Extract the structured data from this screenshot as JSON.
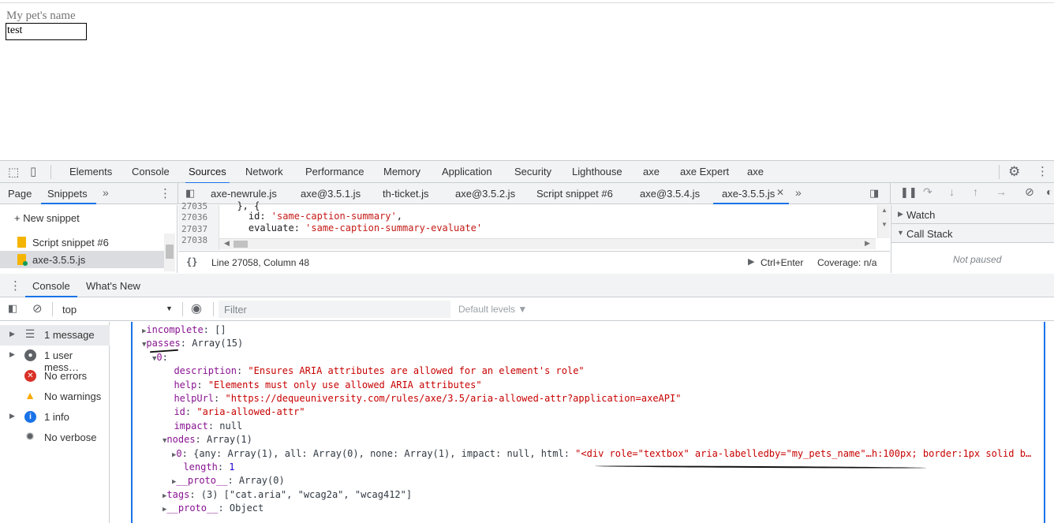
{
  "page": {
    "label": "My pet's name",
    "input_value": "test"
  },
  "devtools": {
    "tabs": [
      "Elements",
      "Console",
      "Sources",
      "Network",
      "Performance",
      "Memory",
      "Application",
      "Security",
      "Lighthouse",
      "axe",
      "axe Expert",
      "axe"
    ],
    "active_tab": "Sources",
    "nav_tabs": [
      "Page",
      "Snippets"
    ],
    "new_snippet": "+ New snippet",
    "snippets": [
      "Script snippet #6",
      "axe-3.5.5.js"
    ],
    "file_tabs": [
      "axe-newrule.js",
      "axe@3.5.1.js",
      "th-ticket.js",
      "axe@3.5.2.js",
      "Script snippet #6",
      "axe@3.5.4.js",
      "axe-3.5.5.js"
    ],
    "editor": {
      "line_numbers": [
        "27035",
        "27036",
        "27037",
        "27038"
      ],
      "lines": [
        {
          "pre": "  }, {",
          "str": ""
        },
        {
          "pre": "    id: ",
          "str": "'same-caption-summary'",
          "post": ","
        },
        {
          "pre": "    evaluate: ",
          "str": "'same-caption-summary-evaluate'",
          "post": ""
        }
      ]
    },
    "status": {
      "position": "Line 27058, Column 48",
      "run": "Ctrl+Enter",
      "coverage": "Coverage: n/a",
      "braces": "{}"
    },
    "debugger": {
      "watch": "Watch",
      "call_stack": "Call Stack",
      "not_paused": "Not paused"
    },
    "drawer_tabs": [
      "Console",
      "What's New"
    ],
    "console_toolbar": {
      "context": "top",
      "filter_placeholder": "Filter",
      "levels": "Default levels ▼"
    },
    "sidebar": [
      {
        "label": "1 message",
        "icon": "list-icon",
        "glyph": "☰",
        "color": "#5f6368",
        "expand": true
      },
      {
        "label": "1 user mess…",
        "icon": "user-icon",
        "glyph": "●",
        "color": "#5f6368",
        "expand": true
      },
      {
        "label": "No errors",
        "icon": "error-icon",
        "glyph": "✕",
        "color": "#d93025",
        "expand": false
      },
      {
        "label": "No warnings",
        "icon": "warning-icon",
        "glyph": "▲",
        "color": "#f9ab00",
        "expand": false
      },
      {
        "label": "1 info",
        "icon": "info-icon",
        "glyph": "i",
        "color": "#1a73e8",
        "expand": true
      },
      {
        "label": "No verbose",
        "icon": "bug-icon",
        "glyph": "✹",
        "color": "#5f6368",
        "expand": false
      }
    ],
    "output": [
      {
        "indent": 0,
        "arrow": "▶",
        "key": "incomplete",
        "val": "[]",
        "vtype": "t"
      },
      {
        "indent": 0,
        "arrow": "▼",
        "key": "passes",
        "val": "Array(15)",
        "vtype": "t"
      },
      {
        "indent": 1,
        "arrow": "▼",
        "key": "0",
        "val": "",
        "vtype": "t"
      },
      {
        "indent": 2,
        "arrow": "",
        "key": "description",
        "val": "\"Ensures ARIA attributes are allowed for an element's role\"",
        "vtype": "s"
      },
      {
        "indent": 2,
        "arrow": "",
        "key": "help",
        "val": "\"Elements must only use allowed ARIA attributes\"",
        "vtype": "s"
      },
      {
        "indent": 2,
        "arrow": "",
        "key": "helpUrl",
        "val": "\"https://dequeuniversity.com/rules/axe/3.5/aria-allowed-attr?application=axeAPI\"",
        "vtype": "s"
      },
      {
        "indent": 2,
        "arrow": "",
        "key": "id",
        "val": "\"aria-allowed-attr\"",
        "vtype": "s"
      },
      {
        "indent": 2,
        "arrow": "",
        "key": "impact",
        "val": "null",
        "vtype": "t"
      },
      {
        "indent": 2,
        "arrow": "▼",
        "key": "nodes",
        "val": "Array(1)",
        "vtype": "t"
      },
      {
        "indent": 3,
        "arrow": "▶",
        "key": "0",
        "val": "{any: Array(1), all: Array(0), none: Array(1), impact: null, html: ",
        "vtype": "t",
        "extra": "\"<div role=\"textbox\" aria-labelledby=\"my_pets_name\"…h:100px; border:1px solid b…"
      },
      {
        "indent": 3,
        "arrow": "",
        "key": "length",
        "val": "1",
        "vtype": "n"
      },
      {
        "indent": 3,
        "arrow": "▶",
        "key": "__proto__",
        "val": "Array(0)",
        "vtype": "t"
      },
      {
        "indent": 2,
        "arrow": "▶",
        "key": "tags",
        "val": "(3) [\"cat.aria\", \"wcag2a\", \"wcag412\"]",
        "vtype": "t"
      },
      {
        "indent": 2,
        "arrow": "▶",
        "key": "__proto__",
        "val": "Object",
        "vtype": "t"
      }
    ]
  }
}
